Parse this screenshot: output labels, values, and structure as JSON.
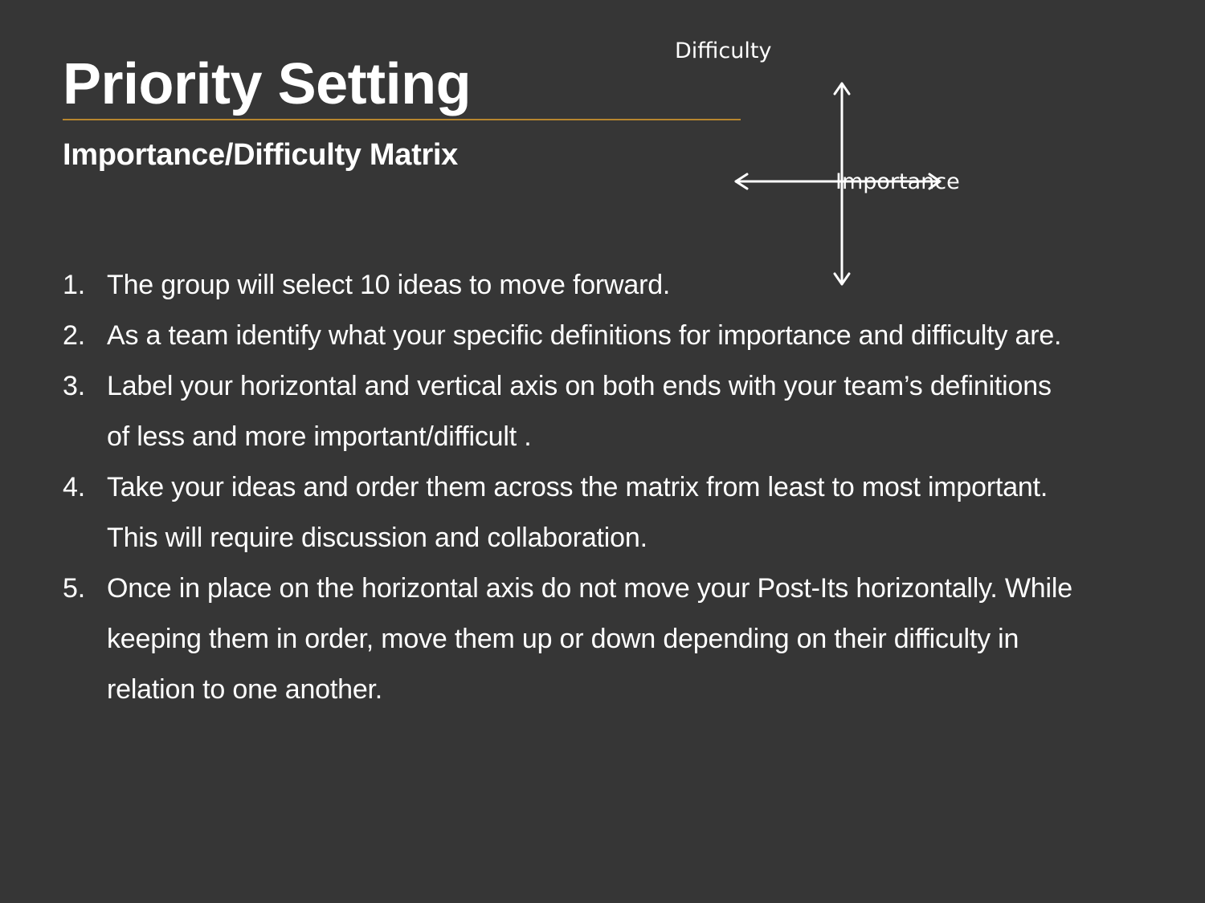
{
  "slide": {
    "title": "Priority Setting",
    "subtitle": "Importance/Difficulty Matrix",
    "accent_color": "#b8862f",
    "background_color": "#363636"
  },
  "matrix": {
    "vertical_axis_label": "Difficulty",
    "horizontal_axis_label": "Importance"
  },
  "steps": [
    {
      "number": "1.",
      "text": "The group will select 10 ideas to move forward."
    },
    {
      "number": "2.",
      "text": "As a team identify what your specific definitions for importance and difficulty are."
    },
    {
      "number": "3.",
      "text": "Label your horizontal and vertical axis on both ends with your team’s definitions of less and more important/difficult ."
    },
    {
      "number": "4.",
      "text": "Take your ideas and order them across the matrix from least to most important. This will require discussion and collaboration."
    },
    {
      "number": "5.",
      "text": "Once in place on the horizontal axis do not move your Post-Its horizontally. While keeping them in order, move them up or down depending on their difficulty in relation to one another."
    }
  ]
}
